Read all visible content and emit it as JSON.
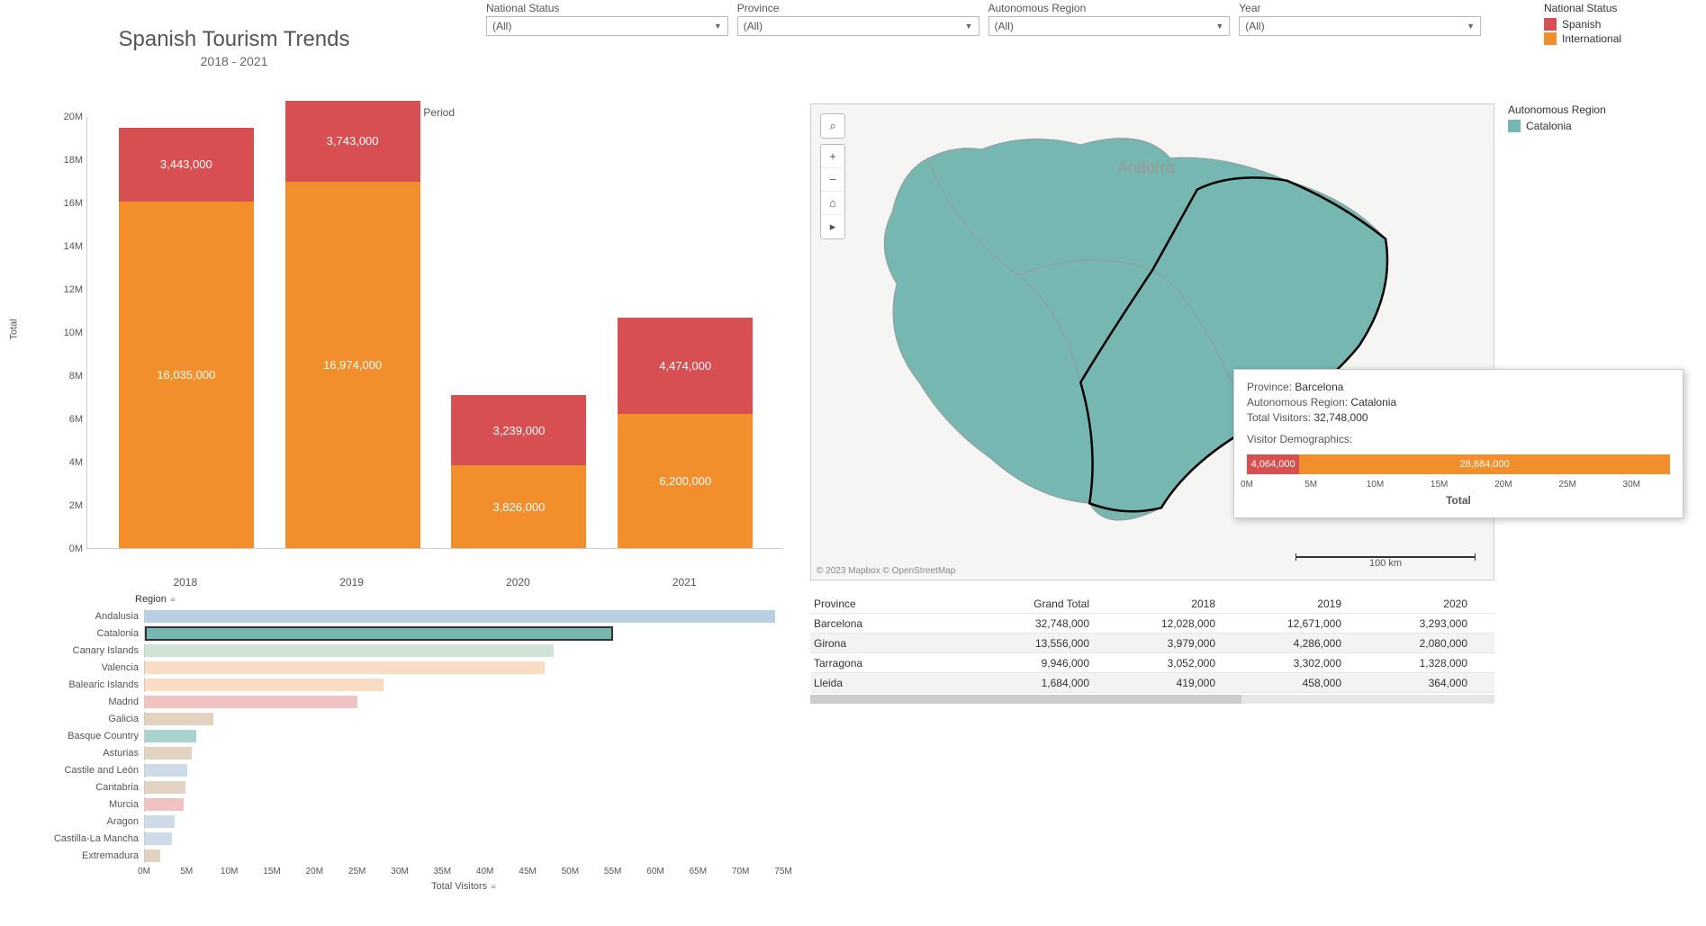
{
  "title": {
    "main": "Spanish Tourism Trends",
    "sub": "2018 - 2021"
  },
  "filters": [
    {
      "label": "National Status",
      "value": "(All)"
    },
    {
      "label": "Province",
      "value": "(All)"
    },
    {
      "label": "Autonomous Region",
      "value": "(All)"
    },
    {
      "label": "Year",
      "value": "(All)"
    }
  ],
  "status_legend": {
    "title": "National Status",
    "items": [
      {
        "label": "Spanish",
        "color": "#d84f52"
      },
      {
        "label": "International",
        "color": "#f28e2b"
      }
    ]
  },
  "map_legend": {
    "title": "Autonomous Region",
    "items": [
      {
        "label": "Catalonia",
        "color": "#76b7b2"
      }
    ]
  },
  "chart_data": [
    {
      "name": "yearly_stacked_bar",
      "type": "bar",
      "stacked": true,
      "period_label": "Period",
      "ylabel": "Total",
      "ylim": [
        0,
        20000000
      ],
      "yticks": [
        "0M",
        "2M",
        "4M",
        "6M",
        "8M",
        "10M",
        "12M",
        "14M",
        "16M",
        "18M",
        "20M"
      ],
      "categories": [
        "2018",
        "2019",
        "2020",
        "2021"
      ],
      "series": [
        {
          "name": "International",
          "color": "#f28e2b",
          "values": [
            16035000,
            16974000,
            3826000,
            6200000
          ]
        },
        {
          "name": "Spanish",
          "color": "#d84f52",
          "values": [
            3443000,
            3743000,
            3239000,
            4474000
          ]
        }
      ],
      "labels_int": [
        "16,035,000",
        "16,974,000",
        "3,826,000",
        "6,200,000"
      ],
      "labels_sp": [
        "3,443,000",
        "3,743,000",
        "3,239,000",
        "4,474,000"
      ]
    },
    {
      "name": "region_hbar",
      "type": "bar",
      "orientation": "horizontal",
      "xlabel": "Total Visitors",
      "xlim": [
        0,
        75000000
      ],
      "xticks": [
        "0M",
        "5M",
        "10M",
        "15M",
        "20M",
        "25M",
        "30M",
        "35M",
        "40M",
        "45M",
        "50M",
        "55M",
        "60M",
        "65M",
        "70M",
        "75M"
      ],
      "title": "Region",
      "rows": [
        {
          "region": "Andalusia",
          "value": 74000000,
          "color": "#b9cfe4"
        },
        {
          "region": "Catalonia",
          "value": 55000000,
          "color": "#76b7b2",
          "selected": true
        },
        {
          "region": "Canary Islands",
          "value": 48000000,
          "color": "#cfe3d7"
        },
        {
          "region": "Valencia",
          "value": 47000000,
          "color": "#f8dcc4"
        },
        {
          "region": "Balearic Islands",
          "value": 28000000,
          "color": "#f8dcc4"
        },
        {
          "region": "Madrid",
          "value": 25000000,
          "color": "#f1c2c2"
        },
        {
          "region": "Galicia",
          "value": 8000000,
          "color": "#e2d3c0"
        },
        {
          "region": "Basque Country",
          "value": 6000000,
          "color": "#a9d3cf"
        },
        {
          "region": "Asturias",
          "value": 5500000,
          "color": "#e2d3c0"
        },
        {
          "region": "Castile and León",
          "value": 5000000,
          "color": "#cddbe9"
        },
        {
          "region": "Cantabria",
          "value": 4800000,
          "color": "#e2d3c0"
        },
        {
          "region": "Murcia",
          "value": 4500000,
          "color": "#f1c2c2"
        },
        {
          "region": "Aragon",
          "value": 3500000,
          "color": "#cddbe9"
        },
        {
          "region": "Castilla-La Mancha",
          "value": 3200000,
          "color": "#cddbe9"
        },
        {
          "region": "Extremadura",
          "value": 1800000,
          "color": "#e2d3c0"
        }
      ]
    },
    {
      "name": "tooltip_demographics_bar",
      "type": "bar",
      "orientation": "horizontal",
      "stacked": true,
      "xlim": [
        0,
        33000000
      ],
      "xticks": [
        "0M",
        "5M",
        "10M",
        "15M",
        "20M",
        "25M",
        "30M"
      ],
      "xlabel": "Total",
      "series": [
        {
          "name": "Spanish",
          "color": "#d84f52",
          "values": [
            4064000
          ]
        },
        {
          "name": "International",
          "color": "#f28e2b",
          "values": [
            28684000
          ]
        }
      ],
      "labels": [
        "4,064,000",
        "28,684,000"
      ]
    }
  ],
  "map": {
    "label_andorra": "Andorra",
    "attribution": "© 2023 Mapbox  © OpenStreetMap",
    "scale_label": "100 km",
    "search_icon": "⌕"
  },
  "tooltip": {
    "prov_label": "Province:",
    "prov_value": "Barcelona",
    "region_label": "Autonomous Region:",
    "region_value": "Catalonia",
    "total_label": "Total Visitors:",
    "total_value": "32,748,000",
    "demo_label": "Visitor Demographics:"
  },
  "table": {
    "headers": [
      "Province",
      "Grand Total",
      "2018",
      "2019",
      "2020"
    ],
    "rows": [
      [
        "Barcelona",
        "32,748,000",
        "12,028,000",
        "12,671,000",
        "3,293,000"
      ],
      [
        "Girona",
        "13,556,000",
        "3,979,000",
        "4,286,000",
        "2,080,000"
      ],
      [
        "Tarragona",
        "9,946,000",
        "3,052,000",
        "3,302,000",
        "1,328,000"
      ],
      [
        "Lleida",
        "1,684,000",
        "419,000",
        "458,000",
        "364,000"
      ]
    ]
  }
}
